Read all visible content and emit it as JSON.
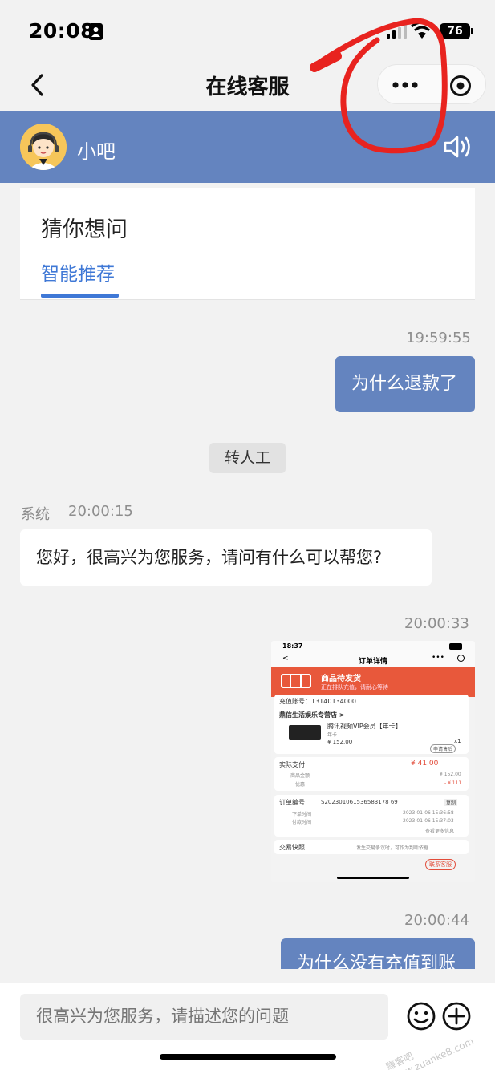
{
  "status_bar": {
    "time": "20:08",
    "battery": "76"
  },
  "nav": {
    "title": "在线客服"
  },
  "agent": {
    "name": "小吧"
  },
  "guess": {
    "title": "猜你想问",
    "tab": "智能推荐"
  },
  "messages": {
    "ts1": "19:59:55",
    "out1": "为什么退款了",
    "transfer": "转人工",
    "system_sender": "系统",
    "system_time": "20:00:15",
    "in1": "您好，很高兴为您服务，请问有什么可以帮您?",
    "ts2": "20:00:33",
    "ts3": "20:00:44",
    "out2": "为什么没有充值到账"
  },
  "image_msg": {
    "time": "18:37",
    "title": "订单详情",
    "banner_title": "商品待发货",
    "banner_sub": "正在排队充值，请耐心等待",
    "account": "充值账号：13140134000",
    "shop": "鼎信生活娱乐专营店 >",
    "product": "腾讯视频VIP会员【年卡】",
    "product_tag": "年卡",
    "price": "¥ 152.00",
    "qty": "x1",
    "after_sale": "申请售后",
    "paid_label": "实际支付",
    "paid": "¥ 41.00",
    "goods_amount_label": "商品金额",
    "goods_amount": "¥ 152.00",
    "discount_label": "优惠",
    "discount": "- ¥ 111",
    "order_no_label": "订单编号",
    "order_no": "S202301061536583178 69",
    "copy": "复制",
    "order_time_label": "下单时间",
    "order_time": "2023-01-06 15:36:58",
    "pay_time_label": "付款时间",
    "pay_time": "2023-01-06 15:37:03",
    "more": "查看更多信息",
    "snapshot": "交易快照",
    "snapshot_sub": "发生交易争议时，可作为判断依据",
    "contact": "联系客服"
  },
  "input": {
    "placeholder": "很高兴为您服务，请描述您的问题"
  },
  "watermark": "赚客吧 www.zuanke8.com",
  "colors": {
    "agent_bar": "#6484bf",
    "accent_blue": "#3f78d6",
    "bubble_out": "#6484bf",
    "annotation_red": "#e8231f",
    "banner_red": "#e8583b"
  }
}
